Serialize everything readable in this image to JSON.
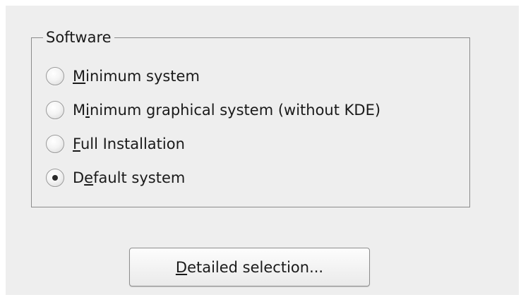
{
  "software": {
    "group_title": "Software",
    "options": [
      {
        "pre": "",
        "mnemonic": "M",
        "post": "inimum system",
        "selected": false
      },
      {
        "pre": "M",
        "mnemonic": "i",
        "post": "nimum graphical system (without KDE)",
        "selected": false
      },
      {
        "pre": "",
        "mnemonic": "F",
        "post": "ull Installation",
        "selected": false
      },
      {
        "pre": "D",
        "mnemonic": "e",
        "post": "fault system",
        "selected": true
      }
    ]
  },
  "detailed_button": {
    "pre": "",
    "mnemonic": "D",
    "post": "etailed selection..."
  }
}
